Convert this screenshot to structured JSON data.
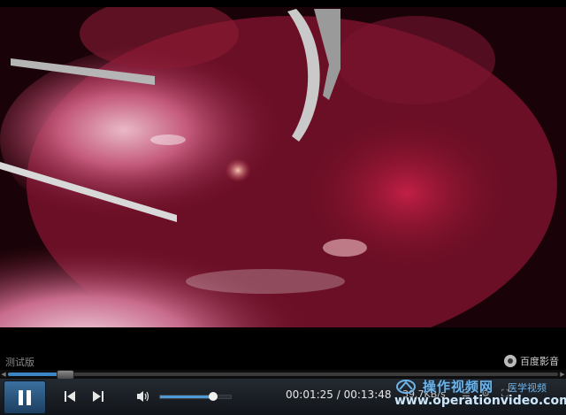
{
  "info": {
    "trial_label": "测试版",
    "brand_name": "百度影音",
    "brand_icon": "film-reel-icon"
  },
  "playback": {
    "current_time": "00:01:25",
    "separator": "/",
    "total_time": "00:13:48",
    "progress": 0.103,
    "download_rate": "39.7KB/s",
    "volume": 0.75
  },
  "controls": {
    "play_pause_icon": "pause-icon",
    "prev_icon": "previous-track-icon",
    "next_icon": "next-track-icon",
    "volume_icon": "speaker-icon"
  },
  "watermark": {
    "cn_title": "操作视频网",
    "cn_sub": "医学视频",
    "url": "www.operationvideo.com"
  },
  "colors": {
    "accent": "#3b86c6",
    "watermark": "#6fb4e8"
  }
}
